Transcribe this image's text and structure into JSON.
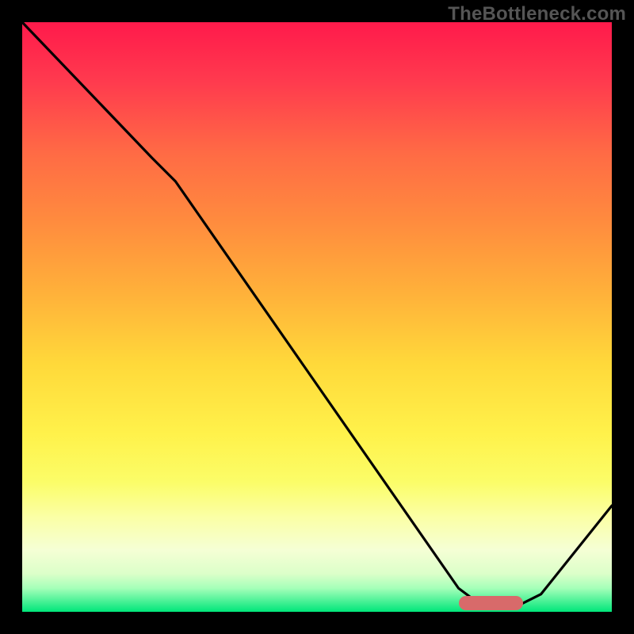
{
  "watermark": "TheBottleneck.com",
  "chart_data": {
    "type": "line",
    "title": "",
    "xlabel": "",
    "ylabel": "",
    "xlim": [
      0,
      100
    ],
    "ylim": [
      0,
      100
    ],
    "series": [
      {
        "name": "bottleneck-curve",
        "x": [
          0,
          22,
          26,
          74,
          78,
          84,
          88,
          100
        ],
        "values": [
          100,
          77,
          73,
          4,
          1,
          1,
          3,
          18
        ]
      }
    ],
    "optimal_range": {
      "x_start": 74,
      "x_end": 85,
      "y": 1.5
    },
    "gradient_stops": [
      {
        "pct": 0,
        "color": "#ff1a4b"
      },
      {
        "pct": 10,
        "color": "#ff3a4e"
      },
      {
        "pct": 22,
        "color": "#ff6a45"
      },
      {
        "pct": 34,
        "color": "#ff8c3e"
      },
      {
        "pct": 46,
        "color": "#ffb13a"
      },
      {
        "pct": 58,
        "color": "#ffd93a"
      },
      {
        "pct": 70,
        "color": "#fff24b"
      },
      {
        "pct": 78,
        "color": "#fbfd68"
      },
      {
        "pct": 84,
        "color": "#fbffa6"
      },
      {
        "pct": 89.5,
        "color": "#f5ffd5"
      },
      {
        "pct": 93.5,
        "color": "#dcffc9"
      },
      {
        "pct": 96,
        "color": "#a5ffb9"
      },
      {
        "pct": 100,
        "color": "#00e67a"
      }
    ]
  }
}
